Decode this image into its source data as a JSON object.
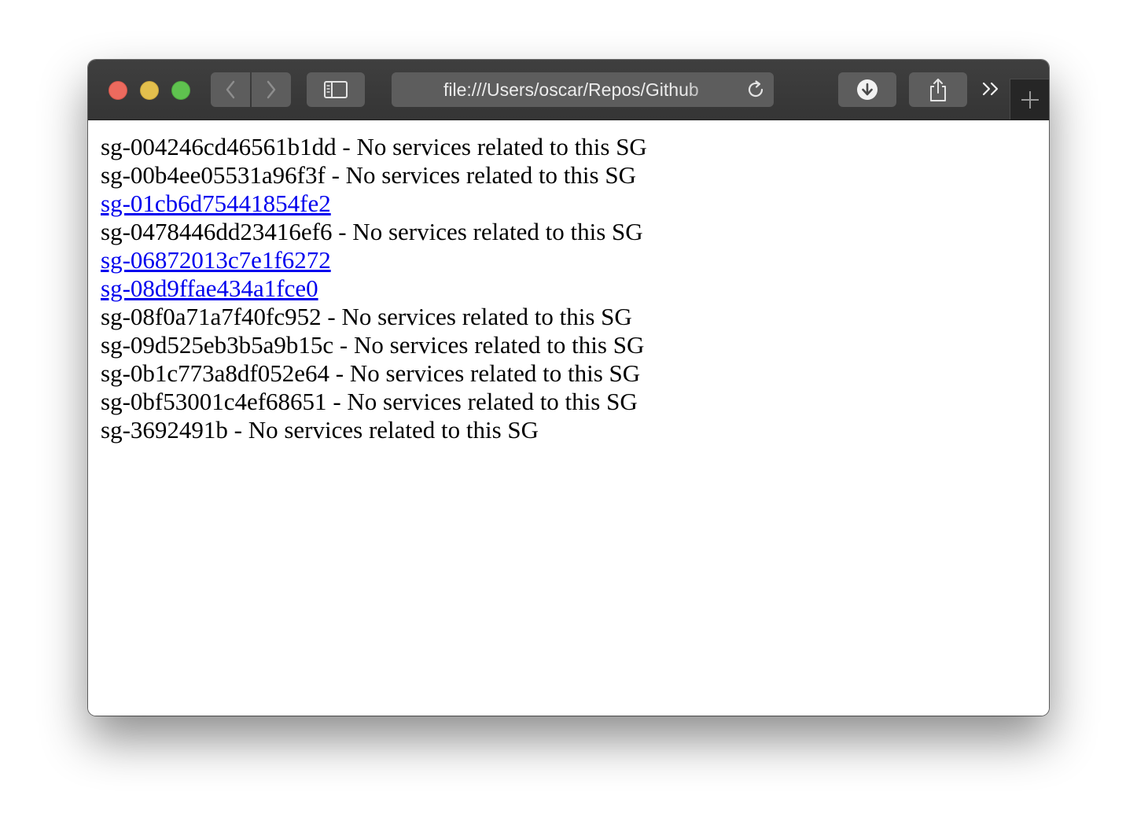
{
  "browser": {
    "url": "file:///Users/oscar/Repos/Github",
    "icons": {
      "back": "chevron-left-icon",
      "forward": "chevron-right-icon",
      "sidebar": "sidebar-icon",
      "reload": "reload-icon",
      "download": "download-icon",
      "share": "share-icon",
      "overflow": "double-chevron-icon",
      "new_tab": "plus-icon"
    }
  },
  "colors": {
    "link": "#0000ee",
    "text": "#000000",
    "titlebar": "#3a3a3a"
  },
  "security_groups": [
    {
      "id": "sg-004246cd46561b1dd",
      "is_link": false,
      "note": " - No services related to this SG"
    },
    {
      "id": "sg-00b4ee05531a96f3f",
      "is_link": false,
      "note": " - No services related to this SG"
    },
    {
      "id": "sg-01cb6d75441854fe2",
      "is_link": true,
      "note": ""
    },
    {
      "id": "sg-0478446dd23416ef6",
      "is_link": false,
      "note": " - No services related to this SG"
    },
    {
      "id": "sg-06872013c7e1f6272",
      "is_link": true,
      "note": ""
    },
    {
      "id": "sg-08d9ffae434a1fce0",
      "is_link": true,
      "note": ""
    },
    {
      "id": "sg-08f0a71a7f40fc952",
      "is_link": false,
      "note": " - No services related to this SG"
    },
    {
      "id": "sg-09d525eb3b5a9b15c",
      "is_link": false,
      "note": " - No services related to this SG"
    },
    {
      "id": "sg-0b1c773a8df052e64",
      "is_link": false,
      "note": " - No services related to this SG"
    },
    {
      "id": "sg-0bf53001c4ef68651",
      "is_link": false,
      "note": " - No services related to this SG"
    },
    {
      "id": "sg-3692491b",
      "is_link": false,
      "note": " - No services related to this SG"
    }
  ]
}
